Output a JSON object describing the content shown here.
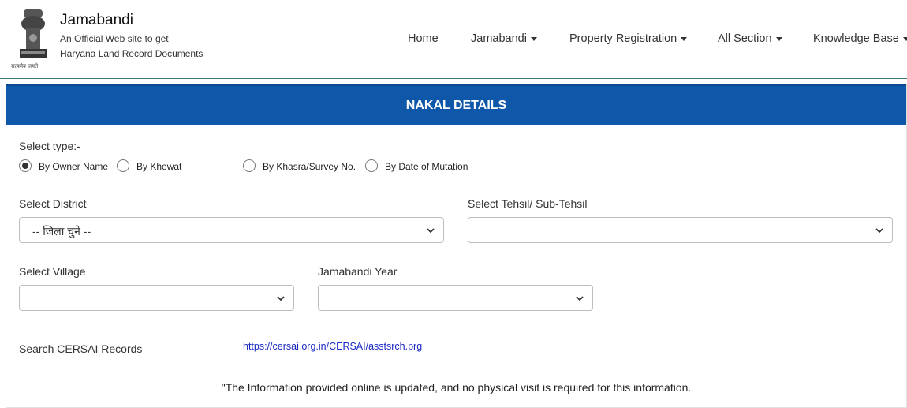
{
  "header": {
    "title": "Jamabandi",
    "subtitle_line1": "An Official Web site to get",
    "subtitle_line2": "Haryana Land Record Documents",
    "emblem_motto": "सत्यमेव जयते"
  },
  "nav": {
    "items": [
      {
        "label": "Home",
        "dropdown": false
      },
      {
        "label": "Jamabandi",
        "dropdown": true
      },
      {
        "label": "Property Registration",
        "dropdown": true
      },
      {
        "label": "All Section",
        "dropdown": true
      },
      {
        "label": "Knowledge Base",
        "dropdown": true
      }
    ]
  },
  "card": {
    "title": "NAKAL DETAILS",
    "select_type_label": "Select type:-",
    "radios": [
      {
        "label": "By Owner Name",
        "checked": true
      },
      {
        "label": "By Khewat",
        "checked": false
      },
      {
        "label": "By Khasra/Survey No.",
        "checked": false
      },
      {
        "label": "By Date of Mutation",
        "checked": false
      }
    ],
    "district": {
      "label": "Select District",
      "value": "-- जिला चुने --"
    },
    "tehsil": {
      "label": "Select Tehsil/ Sub-Tehsil",
      "value": ""
    },
    "village": {
      "label": "Select Village",
      "value": ""
    },
    "year": {
      "label": "Jamabandi Year",
      "value": ""
    },
    "cersai": {
      "label": "Search CERSAI Records",
      "link": "https://cersai.org.in/CERSAI/asstsrch.prg"
    },
    "notice": "\"The Information provided online is updated, and no physical visit is required for this information."
  },
  "colors": {
    "header_bar": "#0f57a8",
    "link": "#1a28c2",
    "header_border": "#3a7a76"
  }
}
